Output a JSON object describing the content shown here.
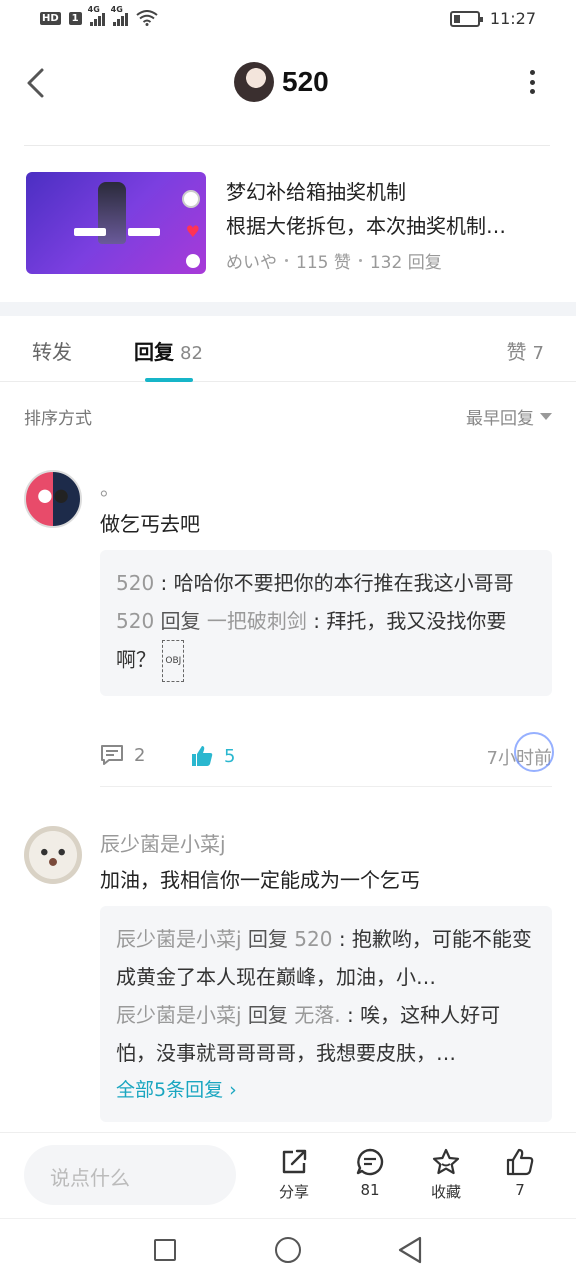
{
  "status": {
    "hd": "HD",
    "sim1": "4G",
    "sim2": "4G",
    "time": "11:27",
    "battery_level": 0.2
  },
  "header": {
    "title": "520"
  },
  "post": {
    "title": "梦幻补给箱抽奖机制",
    "desc": "根据大佬拆包，本次抽奖机制…",
    "author": "めいや",
    "likes": "115 赞",
    "replies": "132 回复"
  },
  "tabs": {
    "forward": "转发",
    "reply": "回复",
    "reply_count": "82",
    "like": "赞",
    "like_count": "7"
  },
  "sort": {
    "label": "排序方式",
    "value": "最早回复"
  },
  "comments": [
    {
      "name": "。",
      "text": "做乞丐去吧",
      "replies": [
        {
          "user": "520",
          "action": "",
          "target": "",
          "text": " : 哈哈你不要把你的本行推在我这小哥哥"
        },
        {
          "user": "520",
          "action": " 回复 ",
          "target": "一把破刺剑",
          "text": " : 拜托，我又没找你要啊？",
          "obj": "OBJ"
        }
      ],
      "reply_count": "2",
      "like_count": "5",
      "time": "7小时前"
    },
    {
      "name": "辰少菌是小菜j",
      "text": "加油，我相信你一定能成为一个乞丐",
      "replies": [
        {
          "user": "辰少菌是小菜j",
          "action": " 回复 ",
          "target": "520",
          "text": " : 抱歉哟，可能不能变成黄金了本人现在巅峰，加油，小…"
        },
        {
          "user": "辰少菌是小菜j",
          "action": " 回复 ",
          "target": "无落.",
          "text": " : 唉，这种人好可怕，没事就哥哥哥哥，我想要皮肤，…"
        }
      ],
      "all_replies": "全部5条回复 ›"
    }
  ],
  "actionbar": {
    "placeholder": "说点什么",
    "share": "分享",
    "comment_count": "81",
    "fav": "收藏",
    "like_count": "7"
  },
  "colors": {
    "accent": "#17b5c8",
    "like": "#2ab7cf"
  }
}
